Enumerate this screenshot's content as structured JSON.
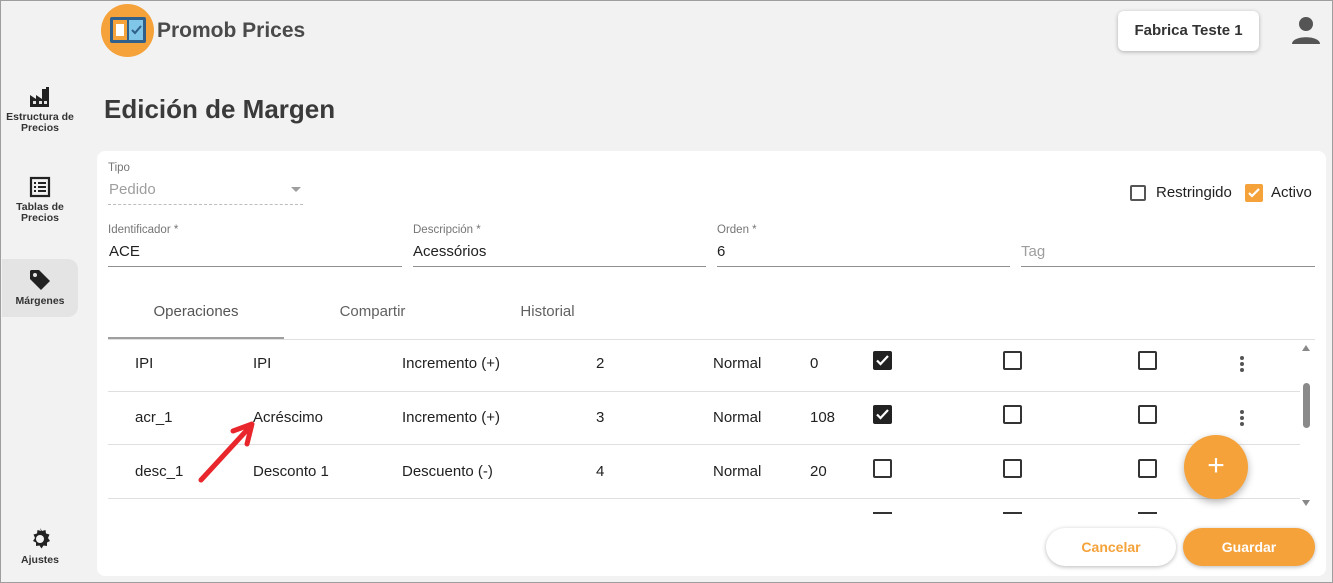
{
  "app": {
    "title": "Promob Prices",
    "company": "Fabrica Teste 1"
  },
  "sidebar": {
    "items": [
      {
        "label_line1": "Estructura de",
        "label_line2": "Precios",
        "icon": "factory-icon"
      },
      {
        "label_line1": "Tablas de",
        "label_line2": "Precios",
        "icon": "list-icon"
      },
      {
        "label_line1": "Márgenes",
        "label_line2": "",
        "icon": "tag-icon"
      },
      {
        "label_line1": "Ajustes",
        "label_line2": "",
        "icon": "gear-icon"
      }
    ],
    "active_index": 2
  },
  "page": {
    "title": "Edición de Margen"
  },
  "form": {
    "tipo": {
      "label": "Tipo",
      "value": "Pedido"
    },
    "restringido": {
      "label": "Restringido",
      "checked": false
    },
    "activo": {
      "label": "Activo",
      "checked": true
    },
    "identificador": {
      "label": "Identificador *",
      "value": "ACE"
    },
    "descripcion": {
      "label": "Descripción *",
      "value": "Acessórios"
    },
    "orden": {
      "label": "Orden *",
      "value": "6"
    },
    "tag": {
      "placeholder": "Tag"
    }
  },
  "tabs": [
    {
      "label": "Operaciones",
      "active": true
    },
    {
      "label": "Compartir",
      "active": false
    },
    {
      "label": "Historial",
      "active": false
    }
  ],
  "table": {
    "rows": [
      {
        "code": "IPI",
        "name": "IPI",
        "operation": "Incremento (+)",
        "order": "2",
        "mode": "Normal",
        "value": "0",
        "check1": true,
        "check2": false,
        "check3": false
      },
      {
        "code": "acr_1",
        "name": "Acréscimo",
        "operation": "Incremento (+)",
        "order": "3",
        "mode": "Normal",
        "value": "108",
        "check1": true,
        "check2": false,
        "check3": false
      },
      {
        "code": "desc_1",
        "name": "Desconto 1",
        "operation": "Descuento (-)",
        "order": "4",
        "mode": "Normal",
        "value": "20",
        "check1": false,
        "check2": false,
        "check3": false
      }
    ]
  },
  "actions": {
    "add": "+",
    "cancel": "Cancelar",
    "save": "Guardar"
  },
  "colors": {
    "accent": "#f5a23a",
    "annotation_arrow": "#e8262b"
  }
}
